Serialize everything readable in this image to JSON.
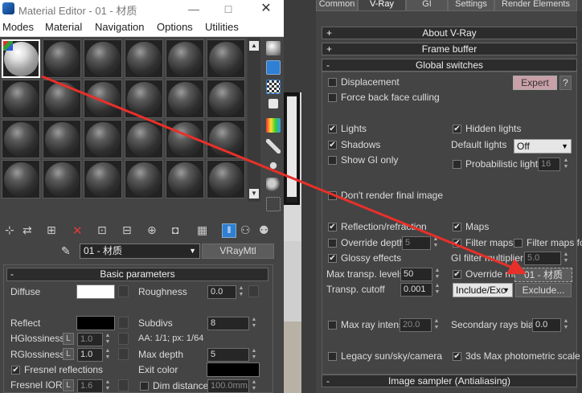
{
  "material_editor": {
    "title": "Material Editor - 01 - 材质",
    "menu": [
      "Modes",
      "Material",
      "Navigation",
      "Options",
      "Utilities"
    ],
    "material_name": "01 - 材质",
    "material_type": "VRayMtl",
    "rollout_title": "Basic parameters",
    "diffuse_label": "Diffuse",
    "roughness_label": "Roughness",
    "roughness_value": "0.0",
    "reflect_label": "Reflect",
    "subdivs_label": "Subdivs",
    "subdivs_value": "8",
    "hglossiness_label": "HGlossiness",
    "hglossiness_value": "1.0",
    "aa_text": "AA: 1/1; px: 1/64",
    "rglossiness_label": "RGlossiness",
    "rglossiness_value": "1.0",
    "max_depth_label": "Max depth",
    "max_depth_value": "5",
    "fresnel_label": "Fresnel reflections",
    "exit_color_label": "Exit color",
    "fresnel_ior_label": "Fresnel IOR",
    "fresnel_ior_value": "1.6",
    "dim_distance_label": "Dim distance",
    "dim_distance_value": "100.0mm",
    "l_button": "L"
  },
  "render_setup": {
    "tabs": [
      "Common",
      "V-Ray",
      "GI",
      "Settings",
      "Render Elements"
    ],
    "active_tab": "V-Ray",
    "rollouts": {
      "about": "About V-Ray",
      "frame_buffer": "Frame buffer",
      "global_switches": "Global switches",
      "image_sampler": "Image sampler (Antialiasing)"
    },
    "displacement": "Displacement",
    "force_back_face": "Force back face culling",
    "expert_button": "Expert",
    "help_button": "?",
    "lights": "Lights",
    "hidden_lights": "Hidden lights",
    "shadows": "Shadows",
    "default_lights_label": "Default lights",
    "default_lights_value": "Off",
    "show_gi_only": "Show GI only",
    "probabilistic_lights": "Probabilistic lights",
    "probabilistic_value": "16",
    "dont_render": "Don't render final image",
    "reflection_refraction": "Reflection/refraction",
    "maps": "Maps",
    "override_depth": "Override depth",
    "override_depth_value": "5",
    "filter_maps": "Filter maps",
    "filter_maps_gi": "Filter maps for GI",
    "glossy_effects": "Glossy effects",
    "gi_filter_multiplier": "GI filter multiplier",
    "gi_filter_value": "5.0",
    "max_transp_label": "Max transp. levels",
    "max_transp_value": "50",
    "override_mtl": "Override mtl",
    "override_mtl_value": "01 - 材质",
    "transp_cutoff_label": "Transp. cutoff",
    "transp_cutoff_value": "0.001",
    "include_exclude_value": "Include/Exc",
    "exclude_button": "Exclude...",
    "max_ray_intens": "Max ray intens",
    "max_ray_value": "20.0",
    "secondary_rays_label": "Secondary rays bias",
    "secondary_rays_value": "0.0",
    "legacy_sun": "Legacy sun/sky/camera",
    "photometric_scale": "3ds Max photometric scale"
  },
  "colors": {
    "arrow": "#e8302a",
    "panel": "#444444",
    "rollout": "#2c2c2c",
    "expert": "#c9a0a8"
  },
  "icons": [
    "close-icon",
    "minimize-icon",
    "maximize-icon",
    "eyedropper-icon",
    "dropdown-arrow-icon",
    "sample-type-icon",
    "checker-background-icon",
    "delete-icon"
  ]
}
